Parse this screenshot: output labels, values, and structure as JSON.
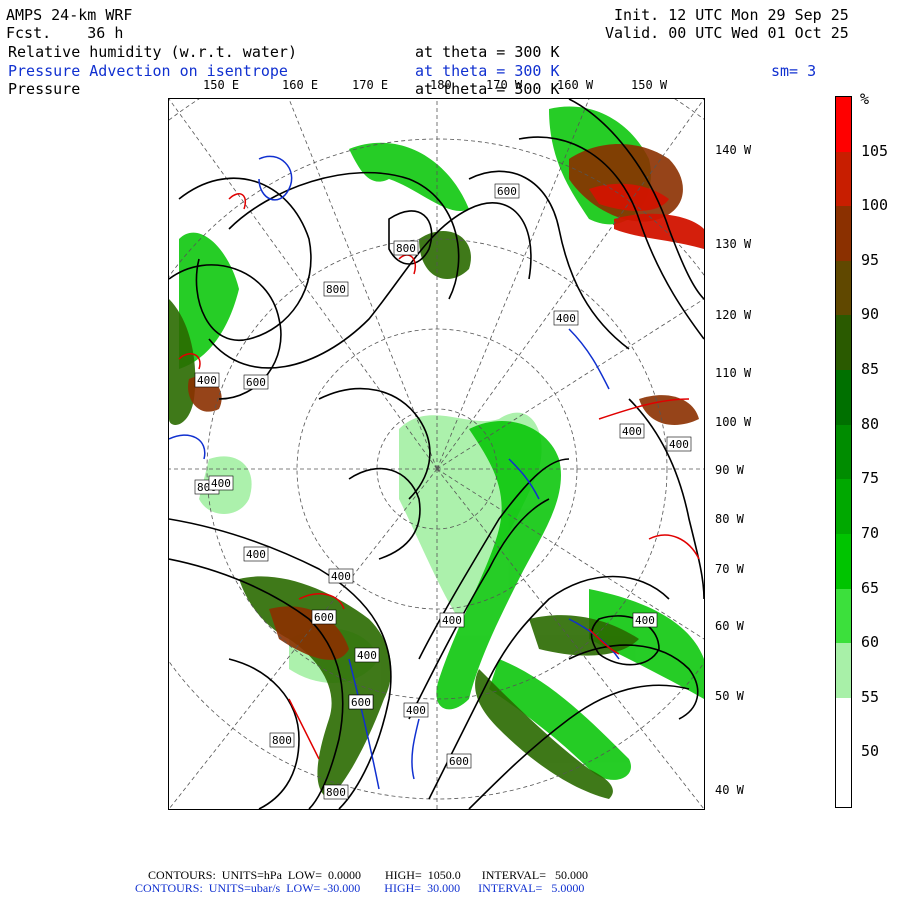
{
  "header": {
    "model": "AMPS 24-km WRF",
    "forecast_label": "Fcst.",
    "forecast_value": "36 h",
    "init": "Init. 12 UTC Mon 29 Sep 25",
    "valid": "Valid. 00 UTC Wed 01 Oct 25",
    "field1": "Relative humidity (w.r.t. water)",
    "field1_level": "at theta = 300 K",
    "field2": "Pressure Advection on isentrope",
    "field2_level": "at theta = 300 K",
    "smoothing": "sm= 3",
    "field3": "Pressure",
    "field3_level": "at theta = 300 K"
  },
  "top_longitudes": [
    "150 E",
    "160 E",
    "170 E",
    "180",
    "170 W",
    "160 W",
    "150 W"
  ],
  "right_longitudes": [
    "140 W",
    "130 W",
    "120 W",
    "110 W",
    "100 W",
    "90 W",
    "80 W",
    "70 W",
    "60 W",
    "50 W",
    "40 W"
  ],
  "contour_labels": [
    "600",
    "800",
    "400",
    "400",
    "600",
    "800",
    "400",
    "400",
    "800",
    "400",
    "400",
    "400",
    "400",
    "400",
    "600",
    "600",
    "400",
    "600",
    "400",
    "800",
    "600",
    "800"
  ],
  "colorbar": {
    "unit": "%",
    "labels": [
      "105",
      "100",
      "95",
      "90",
      "85",
      "80",
      "75",
      "70",
      "65",
      "60",
      "55",
      "50"
    ],
    "colors": [
      "#ff0000",
      "#c81e00",
      "#8b3000",
      "#604800",
      "#2a5a00",
      "#007000",
      "#008c00",
      "#00a800",
      "#00c400",
      "#3ce03c",
      "#a8f0a8",
      "#ffffff",
      "#ffffff"
    ]
  },
  "footer": {
    "line1": "CONTOURS:  UNITS=hPa  LOW=  0.0000        HIGH=  1050.0       INTERVAL=   50.000",
    "line2": "CONTOURS:  UNITS=ubar/s  LOW= -30.000        HIGH=  30.000      INTERVAL=   5.0000"
  }
}
